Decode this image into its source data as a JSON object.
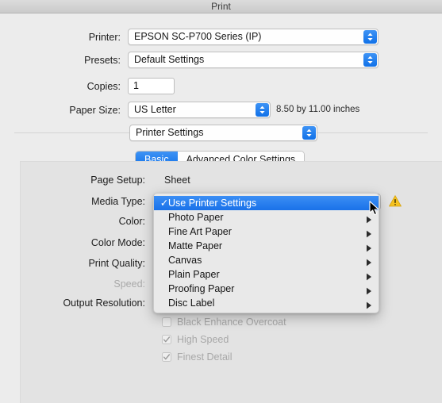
{
  "window": {
    "title": "Print"
  },
  "form": {
    "printer": {
      "label": "Printer:",
      "value": "EPSON SC-P700 Series (IP)"
    },
    "presets": {
      "label": "Presets:",
      "value": "Default Settings"
    },
    "copies": {
      "label": "Copies:",
      "value": "1"
    },
    "paper_size": {
      "label": "Paper Size:",
      "value": "US Letter",
      "note": "8.50 by 11.00 inches"
    },
    "pane_selector": {
      "value": "Printer Settings"
    }
  },
  "tabs": [
    {
      "label": "Basic",
      "active": true
    },
    {
      "label": "Advanced Color Settings",
      "active": false
    }
  ],
  "settings": {
    "page_setup": {
      "label": "Page Setup:",
      "value": "Sheet"
    },
    "media_type": {
      "label": "Media Type:",
      "value": "Use Printer Settings"
    },
    "color": {
      "label": "Color:"
    },
    "color_mode": {
      "label": "Color Mode:"
    },
    "print_quality": {
      "label": "Print Quality:"
    },
    "speed": {
      "label": "Speed:",
      "disabled": true
    },
    "output_resolution": {
      "label": "Output Resolution:"
    }
  },
  "checkboxes": [
    {
      "label": "Black Enhance Overcoat",
      "checked": false
    },
    {
      "label": "High Speed",
      "checked": true
    },
    {
      "label": "Finest Detail",
      "checked": true
    }
  ],
  "media_menu": {
    "items": [
      {
        "label": "Use Printer Settings",
        "selected": true,
        "checked": true,
        "submenu": false
      },
      {
        "label": "Photo Paper",
        "selected": false,
        "checked": false,
        "submenu": true
      },
      {
        "label": "Fine Art Paper",
        "selected": false,
        "checked": false,
        "submenu": true
      },
      {
        "label": "Matte Paper",
        "selected": false,
        "checked": false,
        "submenu": true
      },
      {
        "label": "Canvas",
        "selected": false,
        "checked": false,
        "submenu": true
      },
      {
        "label": "Plain Paper",
        "selected": false,
        "checked": false,
        "submenu": true
      },
      {
        "label": "Proofing Paper",
        "selected": false,
        "checked": false,
        "submenu": true
      },
      {
        "label": "Disc Label",
        "selected": false,
        "checked": false,
        "submenu": true
      }
    ],
    "checkmark_glyph": "✓",
    "submenu_glyph": "▶"
  },
  "icons": {
    "warning": "warning-triangle-icon",
    "cursor": "mouse-arrow-cursor"
  },
  "colors": {
    "accent_blue": "#1a72e9",
    "warning_yellow": "#f4c11e",
    "window_bg": "#ececec",
    "panel_bg": "#e3e3e3"
  }
}
